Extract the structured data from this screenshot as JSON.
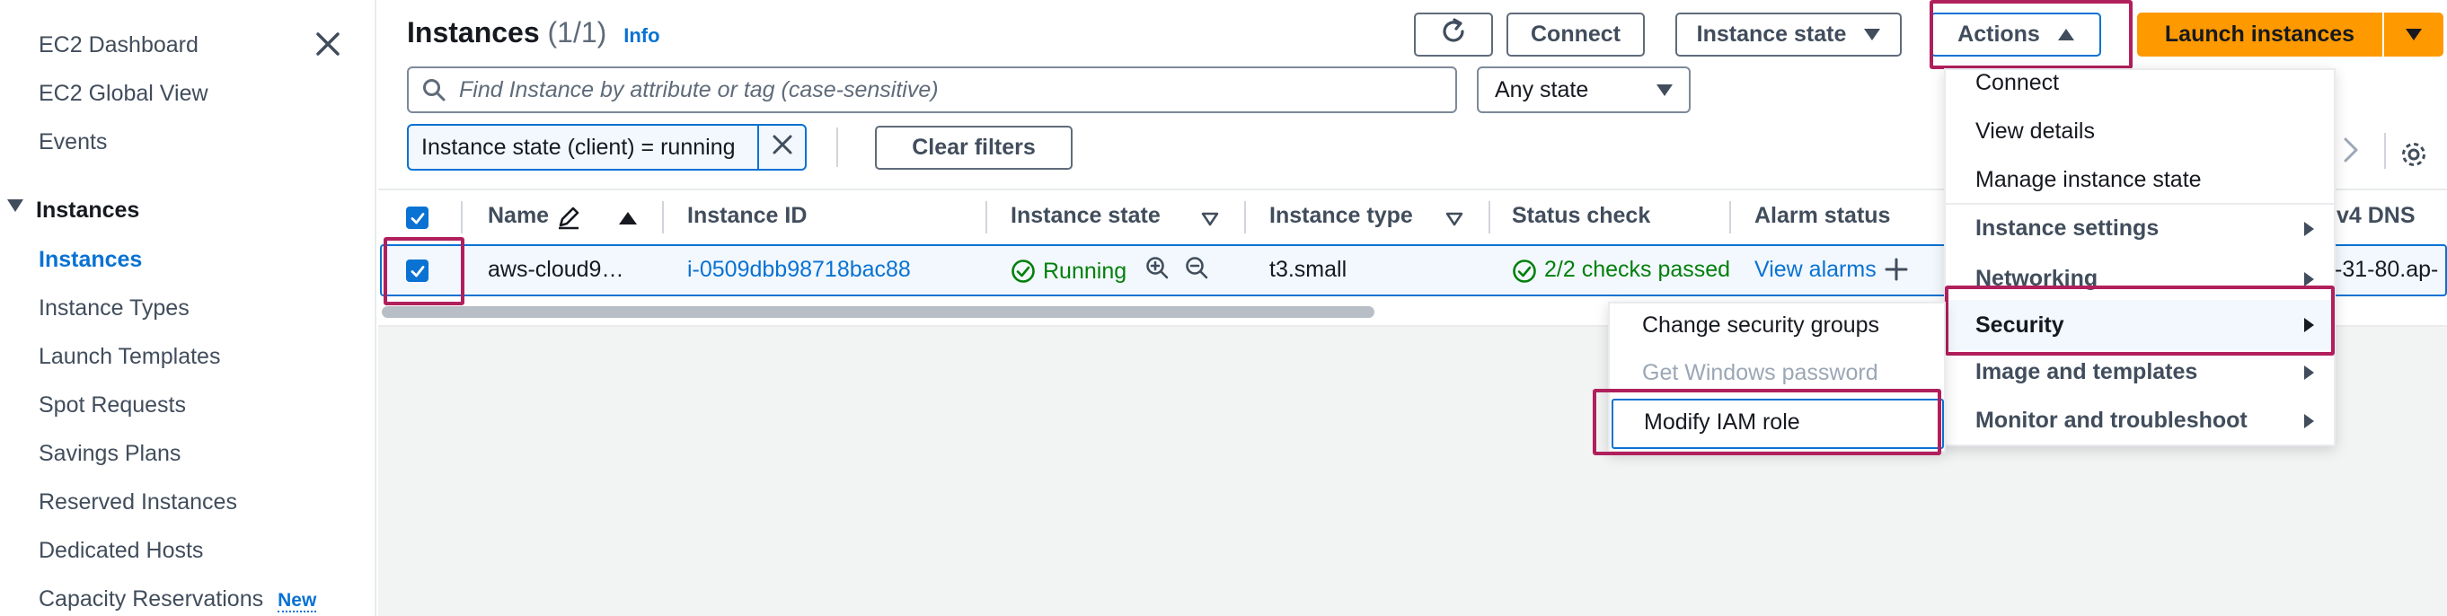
{
  "sidebar": {
    "items": [
      {
        "label": "EC2 Dashboard"
      },
      {
        "label": "EC2 Global View"
      },
      {
        "label": "Events"
      },
      {
        "label": "Instances"
      },
      {
        "label": "Instances"
      },
      {
        "label": "Instance Types"
      },
      {
        "label": "Launch Templates"
      },
      {
        "label": "Spot Requests"
      },
      {
        "label": "Savings Plans"
      },
      {
        "label": "Reserved Instances"
      },
      {
        "label": "Dedicated Hosts"
      },
      {
        "label": "Capacity Reservations"
      }
    ],
    "new_badge": "New"
  },
  "header": {
    "title": "Instances",
    "count": "(1/1)",
    "info": "Info",
    "connect_label": "Connect",
    "instance_state_label": "Instance state",
    "actions_label": "Actions",
    "launch_label": "Launch instances"
  },
  "search": {
    "placeholder": "Find Instance by attribute or tag (case-sensitive)",
    "state_select": "Any state"
  },
  "filters": {
    "token": "Instance state (client) = running",
    "clear_label": "Clear filters"
  },
  "table": {
    "columns": [
      "Name",
      "Instance ID",
      "Instance state",
      "Instance type",
      "Status check",
      "Alarm status",
      "v4 DNS"
    ],
    "rows": [
      {
        "name": "aws-cloud9…",
        "instance_id": "i-0509dbb98718bac88",
        "state": "Running",
        "type": "t3.small",
        "status_check": "2/2 checks passed",
        "alarm_status": "View alarms",
        "dns": "-31-80.ap-"
      }
    ]
  },
  "actions_menu": {
    "items": [
      {
        "label": "Connect",
        "submenu": false
      },
      {
        "label": "View details",
        "submenu": false
      },
      {
        "label": "Manage instance state",
        "submenu": false
      },
      {
        "label": "Instance settings",
        "submenu": true
      },
      {
        "label": "Networking",
        "submenu": true
      },
      {
        "label": "Security",
        "submenu": true
      },
      {
        "label": "Image and templates",
        "submenu": true
      },
      {
        "label": "Monitor and troubleshoot",
        "submenu": true
      }
    ]
  },
  "security_submenu": {
    "items": [
      {
        "label": "Change security groups",
        "disabled": false
      },
      {
        "label": "Get Windows password",
        "disabled": true
      },
      {
        "label": "Modify IAM role",
        "disabled": false
      }
    ]
  },
  "colors": {
    "accent": "#0972d3",
    "primary": "#ff9900",
    "success": "#037f0c",
    "highlight": "#b11f5c"
  },
  "icons": [
    "close-icon",
    "refresh-icon",
    "search-icon",
    "dismiss-icon",
    "edit-icon",
    "sort-ascending-icon",
    "filter-caret-icon",
    "success-icon",
    "zoom-in-icon",
    "zoom-out-icon",
    "plus-icon",
    "next-page-icon",
    "settings-gear-icon"
  ]
}
